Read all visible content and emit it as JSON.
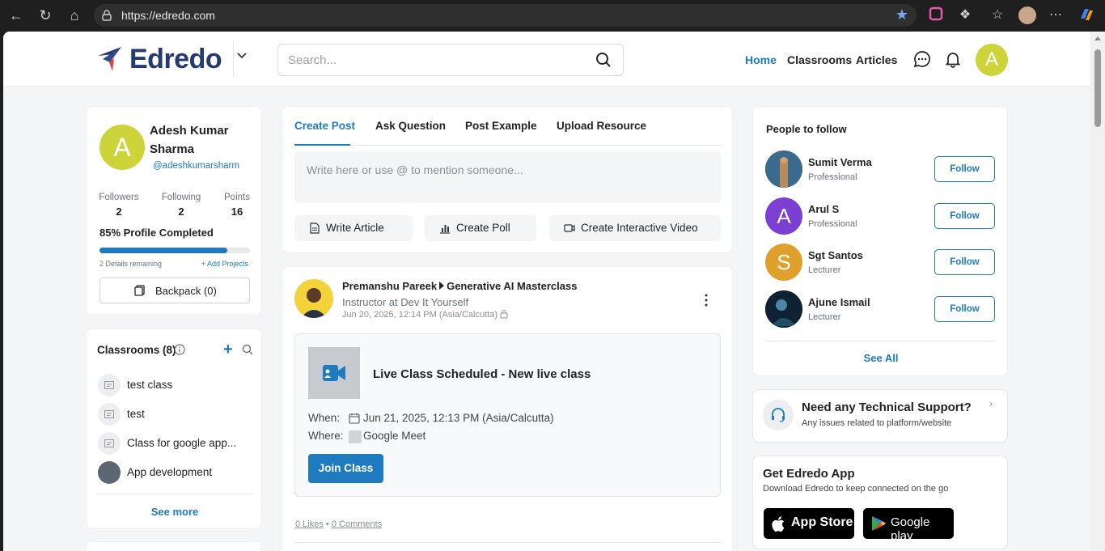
{
  "browser": {
    "url": "https://edredo.com"
  },
  "header": {
    "logo_text": "Edredo",
    "search_placeholder": "Search...",
    "nav": [
      "Home",
      "Classrooms",
      "Articles"
    ],
    "avatar_letter": "A"
  },
  "profile": {
    "avatar_letter": "A",
    "name": "Adesh Kumar Sharma",
    "handle": "@adeshkumarsharm",
    "stats": [
      {
        "label": "Followers",
        "value": "2"
      },
      {
        "label": "Following",
        "value": "2"
      },
      {
        "label": "Points",
        "value": "16"
      }
    ],
    "completion_label": "85% Profile Completed",
    "completion_fraction": 0.85,
    "details_remaining": "2 Details remaining",
    "add_projects": "+ Add Projects",
    "backpack": "Backpack (0)"
  },
  "classrooms": {
    "title": "Classrooms (8)",
    "items": [
      "test class",
      "test",
      "Class for google app...",
      "App development"
    ],
    "see_more": "See more"
  },
  "composer": {
    "tabs": [
      "Create Post",
      "Ask Question",
      "Post Example",
      "Upload Resource"
    ],
    "placeholder": "Write here or use @ to mention someone...",
    "actions": [
      "Write Article",
      "Create Poll",
      "Create Interactive Video"
    ]
  },
  "post": {
    "author": "Premanshu Pareek",
    "group": "Generative AI Masterclass",
    "role": "Instructor at Dev It Yourself",
    "time": "Jun 20, 2025, 12:14 PM (Asia/Calcutta)",
    "live_title": "Live Class Scheduled - New live class",
    "when_label": "When:",
    "when_value": "Jun 21, 2025, 12:13 PM (Asia/Calcutta)",
    "where_label": "Where:",
    "where_value": "Google Meet",
    "join_label": "Join Class",
    "likes": "0 Likes",
    "comments": "0 Comments"
  },
  "people": {
    "title": "People to follow",
    "list": [
      {
        "name": "Sumit Verma",
        "role": "Professional",
        "letter": "",
        "color": "#2b4a63"
      },
      {
        "name": "Arul S",
        "role": "Professional",
        "letter": "A",
        "color": "#7b3fd1"
      },
      {
        "name": "Sgt Santos",
        "role": "Lecturer",
        "letter": "S",
        "color": "#e0a12c"
      },
      {
        "name": "Ajune Ismail",
        "role": "Lecturer",
        "letter": "",
        "color": "#0f2233"
      }
    ],
    "follow_label": "Follow",
    "see_all": "See All"
  },
  "support": {
    "title": "Need any Technical Support?",
    "subtitle": "Any issues related to platform/website"
  },
  "app": {
    "title": "Get Edredo App",
    "subtitle": "Download Edredo to keep connected on the go",
    "app_store": "App Store",
    "google_play": "Google play"
  },
  "colors": {
    "accent": "#1e7bbf",
    "avatar": "#cdd43a"
  }
}
